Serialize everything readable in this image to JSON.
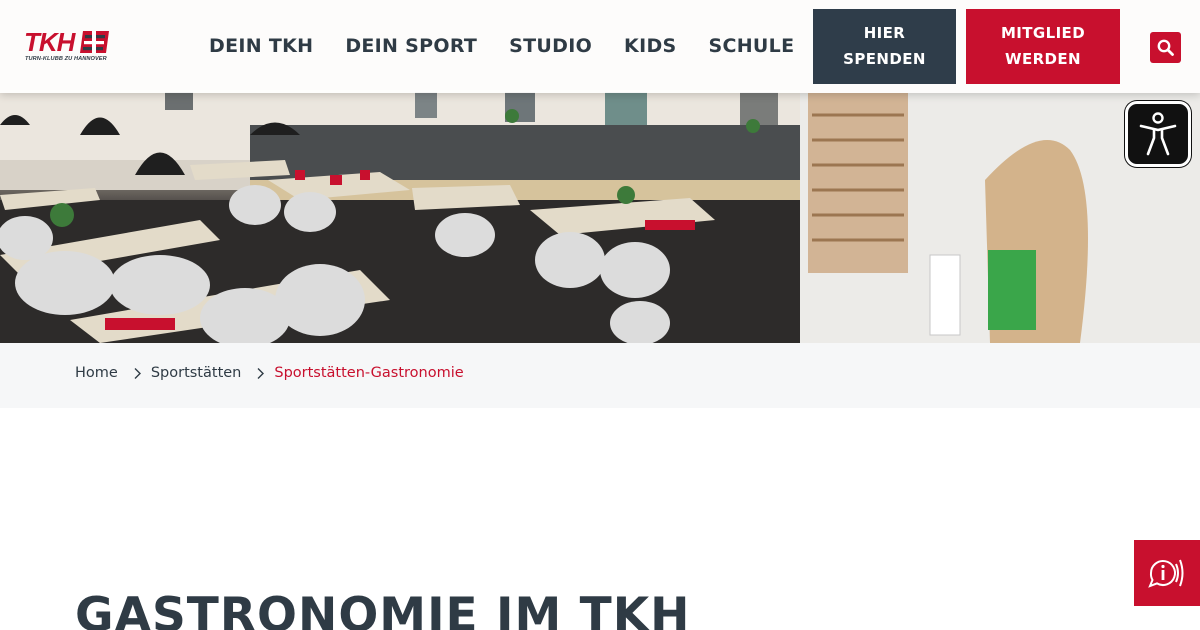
{
  "logo": {
    "mark": "TKH",
    "subtitle": "TURN-KLUBB ZU HANNOVER"
  },
  "nav": {
    "items": [
      {
        "label": "DEIN TKH"
      },
      {
        "label": "DEIN SPORT"
      },
      {
        "label": "STUDIO"
      },
      {
        "label": "KIDS"
      },
      {
        "label": "SCHULE"
      }
    ]
  },
  "cta": {
    "donate_line1": "HIER",
    "donate_line2": "SPENDEN",
    "member_line1": "MITGLIED",
    "member_line2": "WERDEN"
  },
  "icons": {
    "search": "search-icon",
    "accessibility": "accessibility-icon",
    "info": "info-speech-icon",
    "breadcrumb_separator": "chevron-right-icon"
  },
  "breadcrumb": {
    "items": [
      {
        "label": "Home"
      },
      {
        "label": "Sportstätten"
      },
      {
        "label": "Sportstätten-Gastronomie"
      }
    ]
  },
  "page": {
    "title": "GASTRONOMIE IM TKH"
  },
  "colors": {
    "brand_red": "#c8102e",
    "navy": "#2f3d4a",
    "text_dark": "#2f3b45",
    "crumb_bg": "#f6f7f8"
  }
}
